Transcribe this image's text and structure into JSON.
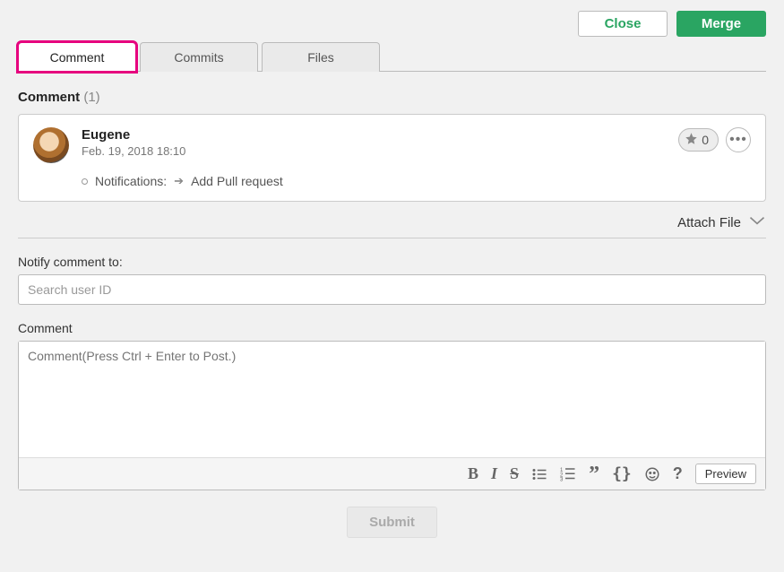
{
  "header": {
    "close_label": "Close",
    "merge_label": "Merge"
  },
  "tabs": {
    "comment": "Comment",
    "commits": "Commits",
    "files": "Files"
  },
  "section": {
    "title": "Comment",
    "count": "(1)"
  },
  "comment": {
    "author": "Eugene",
    "timestamp": "Feb. 19, 2018 18:10",
    "star_count": "0",
    "notif_label": "Notifications:",
    "notif_action": "Add Pull request"
  },
  "attach": {
    "label": "Attach File"
  },
  "notify": {
    "label": "Notify comment to:",
    "placeholder": "Search user ID"
  },
  "editor": {
    "label": "Comment",
    "placeholder": "Comment(Press Ctrl + Enter to Post.)",
    "preview_label": "Preview"
  },
  "submit": {
    "label": "Submit"
  }
}
